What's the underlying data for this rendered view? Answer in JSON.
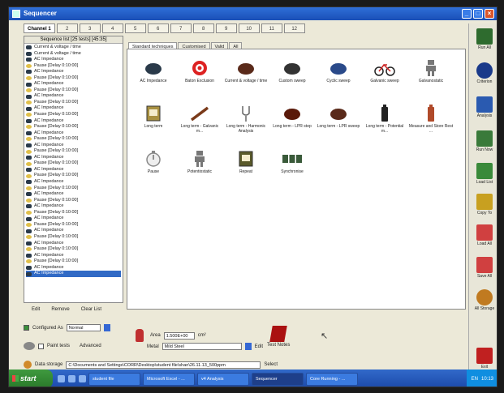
{
  "window": {
    "title": "Sequencer"
  },
  "channels": [
    "Channel 1",
    "2",
    "3",
    "4",
    "5",
    "6",
    "7",
    "8",
    "9",
    "10",
    "11",
    "12"
  ],
  "sequence": {
    "title": "Sequence list [25 tests] [45:35]",
    "items": [
      {
        "label": "Current & voltage / time",
        "kind": "dark"
      },
      {
        "label": "Current & voltage / time",
        "kind": "dark"
      },
      {
        "label": "AC Impedance",
        "kind": "dark"
      },
      {
        "label": "Pause [Delay 0:10:00]",
        "kind": "pause"
      },
      {
        "label": "AC Impedance",
        "kind": "dark"
      },
      {
        "label": "Pause [Delay 0:10:00]",
        "kind": "pause"
      },
      {
        "label": "AC Impedance",
        "kind": "dark"
      },
      {
        "label": "Pause [Delay 0:10:00]",
        "kind": "pause"
      },
      {
        "label": "AC Impedance",
        "kind": "dark"
      },
      {
        "label": "Pause [Delay 0:10:00]",
        "kind": "pause"
      },
      {
        "label": "AC Impedance",
        "kind": "dark"
      },
      {
        "label": "Pause [Delay 0:10:00]",
        "kind": "pause"
      },
      {
        "label": "AC Impedance",
        "kind": "dark"
      },
      {
        "label": "Pause [Delay 0:10:00]",
        "kind": "pause"
      },
      {
        "label": "AC Impedance",
        "kind": "dark"
      },
      {
        "label": "Pause [Delay 0:10:00]",
        "kind": "pause"
      },
      {
        "label": "AC Impedance",
        "kind": "dark"
      },
      {
        "label": "Pause [Delay 0:10:00]",
        "kind": "pause"
      },
      {
        "label": "AC Impedance",
        "kind": "dark"
      },
      {
        "label": "Pause [Delay 0:10:00]",
        "kind": "pause"
      },
      {
        "label": "AC Impedance",
        "kind": "dark"
      },
      {
        "label": "Pause [Delay 0:10:00]",
        "kind": "pause"
      },
      {
        "label": "AC Impedance",
        "kind": "dark"
      },
      {
        "label": "Pause [Delay 0:10:00]",
        "kind": "pause"
      },
      {
        "label": "AC Impedance",
        "kind": "dark"
      },
      {
        "label": "Pause [Delay 0:10:00]",
        "kind": "pause"
      },
      {
        "label": "AC Impedance",
        "kind": "dark"
      },
      {
        "label": "Pause [Delay 0:10:00]",
        "kind": "pause"
      },
      {
        "label": "AC Impedance",
        "kind": "dark"
      },
      {
        "label": "Pause [Delay 0:10:00]",
        "kind": "pause"
      },
      {
        "label": "AC Impedance",
        "kind": "dark"
      },
      {
        "label": "Pause [Delay 0:10:00]",
        "kind": "pause"
      },
      {
        "label": "AC Impedance",
        "kind": "dark"
      },
      {
        "label": "Pause [Delay 0:10:00]",
        "kind": "pause"
      },
      {
        "label": "AC Impedance",
        "kind": "dark"
      },
      {
        "label": "Pause [Delay 0:10:00]",
        "kind": "pause"
      },
      {
        "label": "AC Impedance",
        "kind": "dark"
      },
      {
        "label": "AC Impedance",
        "kind": "dark",
        "selected": true
      }
    ],
    "buttons": {
      "edit": "Edit",
      "remove": "Remove",
      "clear": "Clear List"
    }
  },
  "technique_tabs": [
    "Standard techniques",
    "Customised",
    "Valid",
    "All"
  ],
  "techniques": [
    {
      "label": "AC Impedance",
      "icon": "impedance-icon"
    },
    {
      "label": "Baton Exclusion",
      "icon": "target-icon"
    },
    {
      "label": "Current & voltage / time",
      "icon": "bird-icon"
    },
    {
      "label": "Custom sweep",
      "icon": "pot-icon"
    },
    {
      "label": "Cyclic sweep",
      "icon": "runner-icon"
    },
    {
      "label": "Galvanic sweep",
      "icon": "bicycle-icon"
    },
    {
      "label": "Galvanostatic",
      "icon": "robot-icon"
    },
    {
      "label": "Long term",
      "icon": "calendar-icon"
    },
    {
      "label": "Long term - Galvanic m...",
      "icon": "rod-icon"
    },
    {
      "label": "Long term - Harmonic Analysis",
      "icon": "tuning-fork-icon"
    },
    {
      "label": "Long term - LPR step",
      "icon": "table-icon"
    },
    {
      "label": "Long term - LPR sweep",
      "icon": "bird-icon"
    },
    {
      "label": "Long term - Potential m...",
      "icon": "battery-icon"
    },
    {
      "label": "Measure and Store Rest ...",
      "icon": "bottle-icon"
    },
    {
      "label": "Pause",
      "icon": "stopwatch-icon"
    },
    {
      "label": "Potentiostatic",
      "icon": "robot-icon"
    },
    {
      "label": "Repeat",
      "icon": "repeat-icon"
    },
    {
      "label": "Synchronise",
      "icon": "sync-icon"
    }
  ],
  "right_toolbar": [
    {
      "label": "Run All",
      "icon": "grid-icon"
    },
    {
      "label": "Criterion",
      "icon": "globe-icon"
    },
    {
      "label": "Analysis",
      "icon": "chart-icon"
    },
    {
      "label": "Run Now",
      "icon": "run-now-icon"
    },
    {
      "label": "Load List",
      "icon": "load-list-icon"
    },
    {
      "label": "Copy To",
      "icon": "copy-icon"
    },
    {
      "label": "Load All",
      "icon": "load-all-icon"
    },
    {
      "label": "Save All",
      "icon": "save-all-icon"
    },
    {
      "label": "All Storage",
      "icon": "storage-icon"
    },
    {
      "label": "Exit",
      "icon": "exit-icon"
    }
  ],
  "config": {
    "configured_as_label": "Configured As",
    "configured_as_value": "Normal",
    "paint_tests_label": "Paint tests",
    "advanced_label": "Advanced",
    "area_label": "Area",
    "area_value": "1.500E+00",
    "area_unit": "cm²",
    "metal_label": "Metal",
    "metal_value": "Mild Steel",
    "edit_label": "Edit",
    "test_notes_label": "Test Notes",
    "data_storage_label": "Data storage",
    "data_storage_value": "C:\\Documents and Settings\\CORR\\Desktop\\student file\\shan\\26.11.13_500ppm",
    "select_label": "Select"
  },
  "taskbar": {
    "start": "start",
    "items": [
      "student file",
      "Microsoft Excel - ...",
      "v4 Analysis",
      "Sequencer",
      "Core Running - ..."
    ],
    "active_index": 3,
    "lang": "EN",
    "time": "10:13"
  },
  "colors": {
    "selection": "#316ac5",
    "taskbar": "#245edb",
    "start": "#3a8f3a"
  }
}
